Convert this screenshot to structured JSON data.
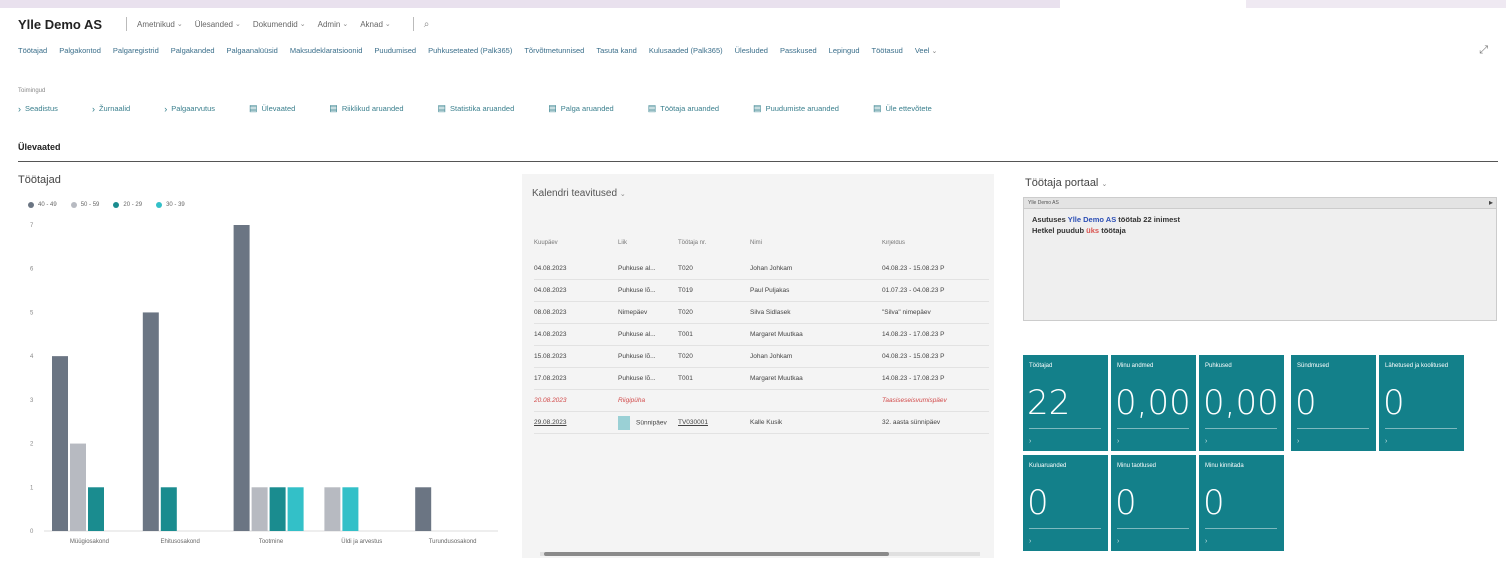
{
  "header": {
    "company": "Ylle Demo AS",
    "menus": [
      "Ametnikud",
      "Ülesanded",
      "Dokumendid",
      "Admin",
      "Aknad"
    ],
    "search_icon": "search-icon"
  },
  "nav": {
    "items": [
      "Töötajad",
      "Palgakontod",
      "Palgaregistrid",
      "Palgakanded",
      "Palgaanalüüsid",
      "Maksudeklaratsioonid",
      "Puudumised",
      "Puhkuseteated (Palk365)",
      "Tõrvõtmetunnised",
      "Tasuta kand",
      "Kulusaaded (Palk365)",
      "Ülesluded",
      "Passkused",
      "Lepingud",
      "Töötasud",
      "Veel"
    ],
    "expand_icon": "expand-icon"
  },
  "actions": {
    "group_label": "Toimingud",
    "items": [
      {
        "icon": "chevron-right-icon",
        "label": "Seadistus"
      },
      {
        "icon": "chevron-right-icon",
        "label": "Žurnaalid"
      },
      {
        "icon": "chevron-right-icon",
        "label": "Palgaarvutus"
      },
      {
        "icon": "report-icon",
        "label": "Ülevaated"
      },
      {
        "icon": "report-icon",
        "label": "Riiklikud aruanded"
      },
      {
        "icon": "report-icon",
        "label": "Statistika aruanded"
      },
      {
        "icon": "report-icon",
        "label": "Palga aruanded"
      },
      {
        "icon": "report-icon",
        "label": "Töötaja aruanded"
      },
      {
        "icon": "report-icon",
        "label": "Puudumiste aruanded"
      },
      {
        "icon": "report-icon",
        "label": "Üle ettevõtete"
      }
    ]
  },
  "section_title": "Ülevaated",
  "chart_data": {
    "type": "bar",
    "title": "Töötajad",
    "categories": [
      "Müügiosakond",
      "Ehitusosakond",
      "Tootmine",
      "Üldi ja arvestus",
      "Turundusosakond"
    ],
    "series": [
      {
        "name": "40 - 49",
        "color": "#6b7583",
        "values": [
          4,
          5,
          7,
          0,
          1
        ]
      },
      {
        "name": "50 - 59",
        "color": "#b7bac1",
        "values": [
          2,
          0,
          1,
          1,
          0
        ]
      },
      {
        "name": "20 - 29",
        "color": "#1a8c8f",
        "values": [
          1,
          1,
          1,
          0,
          0
        ]
      },
      {
        "name": "30 - 39",
        "color": "#33c0c8",
        "values": [
          0,
          0,
          1,
          1,
          0
        ]
      }
    ],
    "y_ticks": [
      "0",
      "1",
      "2",
      "3",
      "4",
      "5",
      "6",
      "7"
    ],
    "ylim": [
      0,
      7
    ],
    "legend_position": "top-left",
    "grid": false
  },
  "calendar": {
    "title": "Kalendri teavitused",
    "columns": [
      "Kuupäev",
      "Liik",
      "Töötaja nr.",
      "Nimi",
      "Kirjeldus"
    ],
    "rows": [
      {
        "date": "04.08.2023",
        "type": "Puhkuse al...",
        "emp": "T020",
        "name": "Johan Johkam",
        "desc": "04.08.23 - 15.08.23 P",
        "style": "normal"
      },
      {
        "date": "04.08.2023",
        "type": "Puhkuse lõ...",
        "emp": "T019",
        "name": "Paul Puljakas",
        "desc": "01.07.23 - 04.08.23 P",
        "style": "normal"
      },
      {
        "date": "08.08.2023",
        "type": "Nimepäev",
        "emp": "T020",
        "name": "Silva Sidlasek",
        "desc": "\"Silva\" nimepäev",
        "style": "normal"
      },
      {
        "date": "14.08.2023",
        "type": "Puhkuse al...",
        "emp": "T001",
        "name": "Margaret Muutkaa",
        "desc": "14.08.23 - 17.08.23 P",
        "style": "normal"
      },
      {
        "date": "15.08.2023",
        "type": "Puhkuse lõ...",
        "emp": "T020",
        "name": "Johan Johkam",
        "desc": "04.08.23 - 15.08.23 P",
        "style": "normal"
      },
      {
        "date": "17.08.2023",
        "type": "Puhkuse lõ...",
        "emp": "T001",
        "name": "Margaret Muutkaa",
        "desc": "14.08.23 - 17.08.23 P",
        "style": "normal"
      },
      {
        "date": "20.08.2023",
        "type": "Riigipüha",
        "emp": "",
        "name": "",
        "desc": "Taasiseseisvumispäev",
        "style": "warn"
      },
      {
        "date": "29.08.2023",
        "type": "Sünnipäev",
        "emp": "TV030001",
        "name": "Kalle Kusik",
        "desc": "32. aasta sünnipäev",
        "style": "link"
      }
    ]
  },
  "portal": {
    "title": "Töötaja portaal",
    "bar_label": "Ylle Demo AS",
    "line1_pre": "Asutuses ",
    "line1_company": "Ylle Demo AS",
    "line1_post": " töötab 22 inimest",
    "line2_pre": "Hetkel puudub ",
    "line2_count": "üks",
    "line2_post": " töötaja"
  },
  "tiles": [
    {
      "label": "Töötajad",
      "value": "22"
    },
    {
      "label": "Minu andmed",
      "value": "0,00"
    },
    {
      "label": "Puhkused",
      "value": "0,00"
    },
    {
      "label": "Sündmused",
      "value": "0"
    },
    {
      "label": "Lähetused ja koolitused",
      "value": "0"
    },
    {
      "label": "Kuluaruanded",
      "value": "0"
    },
    {
      "label": "Minu taotlused",
      "value": "0"
    },
    {
      "label": "Minu kinnitada",
      "value": "0"
    }
  ]
}
